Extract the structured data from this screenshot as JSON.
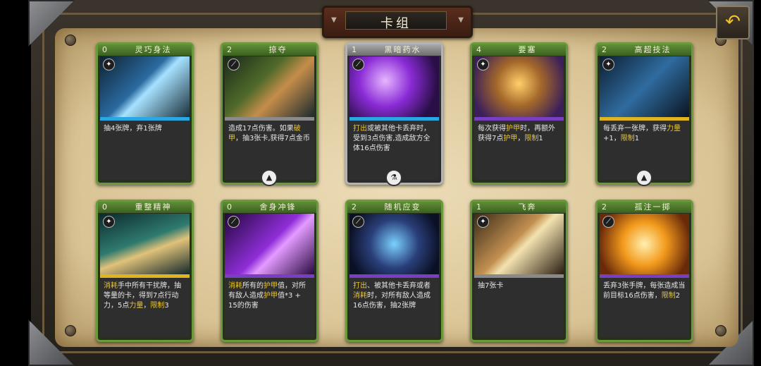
{
  "header": {
    "title": "卡组"
  },
  "back_icon": "back-arrow-icon",
  "cards": [
    {
      "cost": "0",
      "name": "灵巧身法",
      "frame": "green",
      "bar": "blue",
      "desc": [
        {
          "t": "抽4张牌，弃1张牌"
        }
      ],
      "bottom_icon": null
    },
    {
      "cost": "2",
      "name": "掠夺",
      "frame": "green",
      "bar": "gray",
      "desc": [
        {
          "t": "造成17点伤害。如果"
        },
        {
          "t": "破甲",
          "k": true
        },
        {
          "t": "，抽3张卡,获得7点金币"
        }
      ],
      "bottom_icon": "mark-icon"
    },
    {
      "cost": "1",
      "name": "黑暗药水",
      "frame": "gray",
      "bar": "blue",
      "desc": [
        {
          "t": "打出",
          "k": true
        },
        {
          "t": "或被其他卡丢弃时，受到3点伤害,造成敌方全体16点伤害"
        }
      ],
      "bottom_icon": "flask-icon"
    },
    {
      "cost": "4",
      "name": "要塞",
      "frame": "green",
      "bar": "purple",
      "desc": [
        {
          "t": "每次获得"
        },
        {
          "t": "护甲",
          "k": true
        },
        {
          "t": "时，再额外获得7点"
        },
        {
          "t": "护甲",
          "k": true
        },
        {
          "t": "，"
        },
        {
          "t": "限制",
          "k": true
        },
        {
          "t": "1"
        }
      ],
      "bottom_icon": null
    },
    {
      "cost": "2",
      "name": "高超技法",
      "frame": "green",
      "bar": "gold",
      "desc": [
        {
          "t": "每丢弃一张牌，获得"
        },
        {
          "t": "力量",
          "k": true
        },
        {
          "t": "+1，"
        },
        {
          "t": "限制",
          "k": true
        },
        {
          "t": "1"
        }
      ],
      "bottom_icon": "mark-icon"
    },
    {
      "cost": "0",
      "name": "重整精神",
      "frame": "green",
      "bar": "gold",
      "desc": [
        {
          "t": "消耗",
          "k": true
        },
        {
          "t": "手中所有干扰牌，抽等量的卡，得到7点行动力，5点"
        },
        {
          "t": "力量",
          "k": true
        },
        {
          "t": "，"
        },
        {
          "t": "限制",
          "k": true
        },
        {
          "t": "3"
        }
      ],
      "bottom_icon": null
    },
    {
      "cost": "0",
      "name": "舍身冲锋",
      "frame": "green",
      "bar": "purple",
      "desc": [
        {
          "t": "消耗",
          "k": true
        },
        {
          "t": "所有的"
        },
        {
          "t": "护甲",
          "k": true
        },
        {
          "t": "值，对所有敌人造成"
        },
        {
          "t": "护甲",
          "k": true
        },
        {
          "t": "值*3 + 15的伤害"
        }
      ],
      "bottom_icon": null
    },
    {
      "cost": "2",
      "name": "随机应变",
      "frame": "green",
      "bar": "purple",
      "desc": [
        {
          "t": "打出",
          "k": true
        },
        {
          "t": "、被其他卡丢弃或者"
        },
        {
          "t": "消耗",
          "k": true
        },
        {
          "t": "时，对所有敌人造成16点伤害，抽2张牌"
        }
      ],
      "bottom_icon": null
    },
    {
      "cost": "1",
      "name": "飞奔",
      "frame": "green",
      "bar": "gray",
      "desc": [
        {
          "t": "抽7张卡"
        }
      ],
      "bottom_icon": null
    },
    {
      "cost": "2",
      "name": "孤注一掷",
      "frame": "green",
      "bar": "purple",
      "desc": [
        {
          "t": "丢弃3张手牌，每张造成当前目标16点伤害，"
        },
        {
          "t": "限制",
          "k": true
        },
        {
          "t": "2"
        }
      ],
      "bottom_icon": null
    }
  ],
  "colors": {
    "frame_green": "#6a9a3c",
    "keyword": "#e8c534",
    "bar_blue": "#2aa6e0",
    "bar_gold": "#e0b320",
    "bar_purple": "#7a3fc0",
    "bar_gray": "#8a8a8a"
  }
}
